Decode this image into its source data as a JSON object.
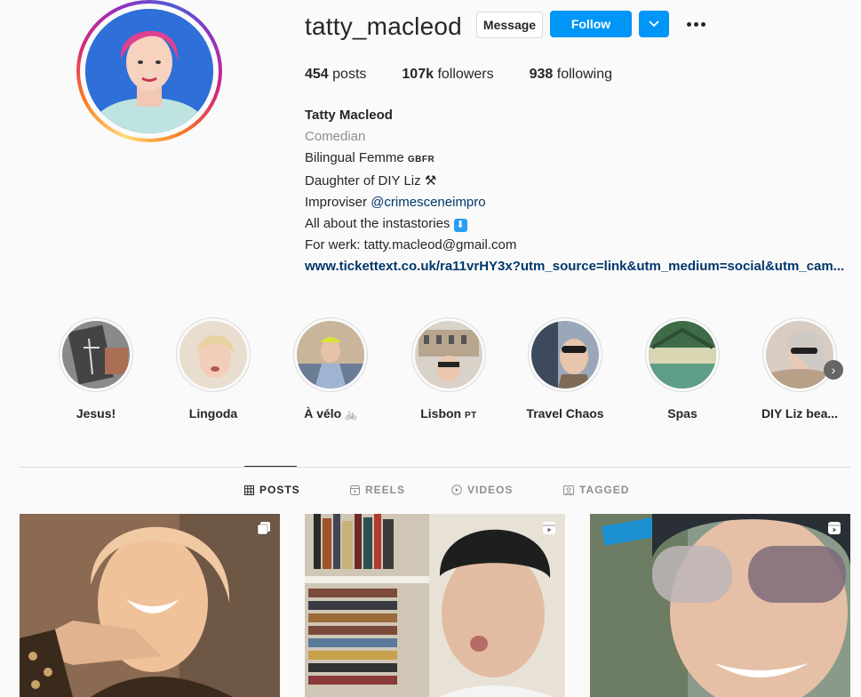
{
  "profile": {
    "username": "tatty_macleod",
    "message_label": "Message",
    "follow_label": "Follow",
    "dropdown_icon": "chevron-down-icon",
    "more_icon": "more-horizontal-icon"
  },
  "stats": {
    "posts_count": "454",
    "posts_label": "posts",
    "followers_count": "107k",
    "followers_label": "followers",
    "following_count": "938",
    "following_label": "following"
  },
  "bio": {
    "name": "Tatty Macleod",
    "category": "Comedian",
    "line1_text": "Bilingual Femme",
    "line1_flag": "GBFR",
    "line2_text": "Daughter of DIY Liz",
    "line2_emoji": "⚒",
    "line3_text": "Improviser",
    "line3_mention": "@crimesceneimpro",
    "line4_text": "All about the instastories",
    "line4_emoji": "⬇",
    "line5_text": "For werk: tatty.macleod@gmail.com",
    "link": "www.tickettext.co.uk/ra11vrHY3x?utm_source=link&utm_medium=social&utm_cam..."
  },
  "highlights": [
    {
      "label": "Jesus!",
      "suffix": ""
    },
    {
      "label": "Lingoda",
      "suffix": ""
    },
    {
      "label": "À vélo",
      "suffix": "🚲"
    },
    {
      "label": "Lisbon",
      "suffix": "PT"
    },
    {
      "label": "Travel Chaos",
      "suffix": ""
    },
    {
      "label": "Spas",
      "suffix": ""
    },
    {
      "label": "DIY Liz bea...",
      "suffix": ""
    }
  ],
  "tabs": [
    {
      "label": "POSTS",
      "icon": "grid-icon"
    },
    {
      "label": "REELS",
      "icon": "reels-icon"
    },
    {
      "label": "VIDEOS",
      "icon": "play-icon"
    },
    {
      "label": "TAGGED",
      "icon": "tag-icon"
    }
  ],
  "colors": {
    "accent": "#0095f6",
    "link": "#00376b",
    "muted": "#8e8e8e",
    "background": "#fafafa"
  }
}
